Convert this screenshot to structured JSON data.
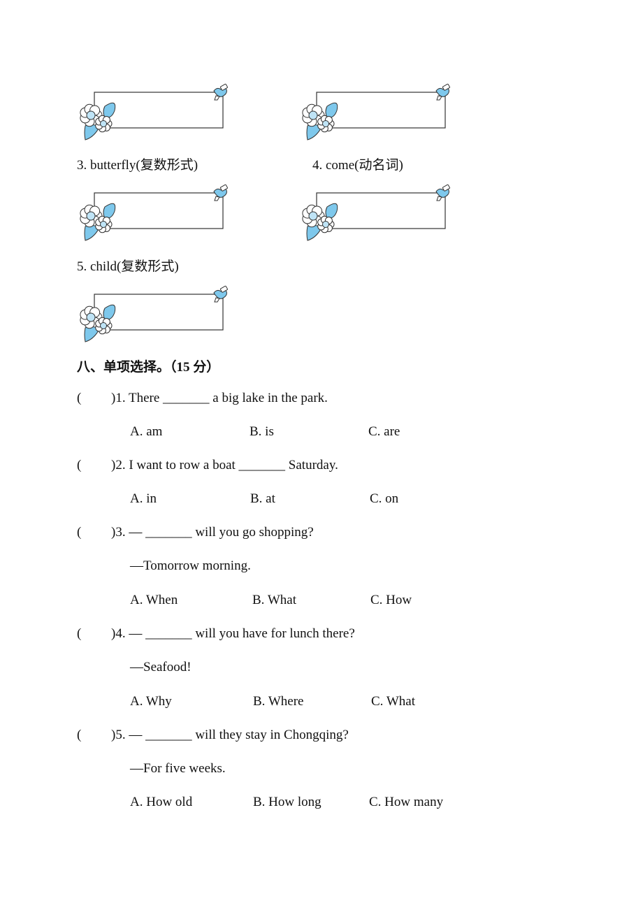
{
  "word_forms": {
    "items": [
      {
        "number": "3.",
        "word": "butterfly",
        "hint": "(复数形式)",
        "label": "3. butterfly(复数形式)"
      },
      {
        "number": "4.",
        "word": "come",
        "hint": "(动名词)",
        "label": "4. come(动名词)"
      },
      {
        "number": "5.",
        "word": "child",
        "hint": "(复数形式)",
        "label": "5. child(复数形式)"
      }
    ],
    "answer_boxes": [
      "",
      "",
      "",
      "",
      ""
    ]
  },
  "section": {
    "title": "八、单项选择。（15 分）"
  },
  "questions": [
    {
      "paren": "(",
      "stem": ")1. There _______ a big lake in the park.",
      "reply": "",
      "options": [
        "A. am",
        "B. is",
        "C. are"
      ]
    },
    {
      "paren": "(",
      "stem": ")2. I want to row a boat _______ Saturday.",
      "reply": "",
      "options": [
        "A. in",
        "B. at",
        "C. on"
      ]
    },
    {
      "paren": "(",
      "stem": ")3. — _______ will you go shopping?",
      "reply": "—Tomorrow morning.",
      "options": [
        "A. When",
        "B. What",
        "C. How"
      ]
    },
    {
      "paren": "(",
      "stem": ")4. — _______ will you have for lunch there?",
      "reply": "—Seafood!",
      "options": [
        "A. Why",
        "B. Where",
        "C. What"
      ]
    },
    {
      "paren": "(",
      "stem": ")5. — _______ will they stay in Chongqing?",
      "reply": "—For five weeks.",
      "options": [
        "A. How old",
        "B. How long",
        "C. How many"
      ]
    }
  ],
  "colors": {
    "accent_blue": "#7ec8ec",
    "light_blue": "#bfe4f6",
    "line": "#333333"
  }
}
